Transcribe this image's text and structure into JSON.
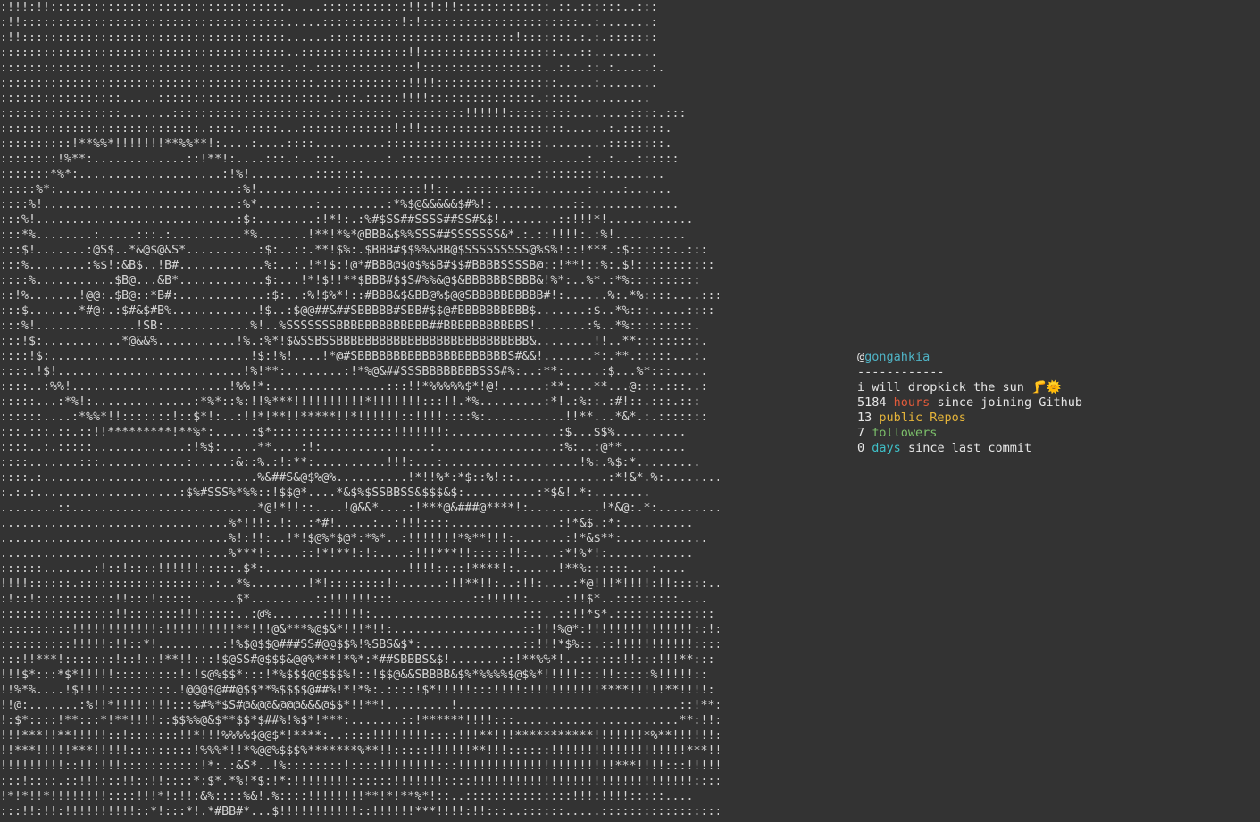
{
  "profile": {
    "at_symbol": "@",
    "username": "gongahkia",
    "separator": "------------",
    "bio": "i will dropkick the sun 🦵🌞",
    "hours": {
      "value": "5184",
      "label": "hours",
      "suffix": "since joining Github"
    },
    "repos": {
      "value": "13",
      "label": "public Repos"
    },
    "followers": {
      "value": "7",
      "label": "followers"
    },
    "days": {
      "value": "0",
      "label": "days",
      "suffix": "since last commit"
    }
  },
  "colors": {
    "background": "#333333",
    "text": "#e6e6e6",
    "username": "#4fb3c5",
    "hours": "#e05a3a",
    "repos": "#e6b53a",
    "followers": "#7cbf6a",
    "days": "#3fc0c8"
  },
  "ascii_art": [
    ":!!!:!!:::::::::::::::::::::::::::::::::.....::::::::::::!!:!:!!:::::::::::::.::.::::::..:::",
    ":!!:::::::::::::::::::::::::::::::::::::.....:::::::::::!:!::::::::::::::::::::::..:.......:",
    ":!!:::::::::::::::::::::::::::::::::::::......::::::::::::::::::::::::::!:::::::.:.:.:::::::",
    "::::::::::::::::::::::::::::::::::::::::..:::::::::::::::!!:::::::::::::::::::...::.........",
    "::::::::::::::::::::::::::::::::::::::::.::.::::::::::::::!:::::::::::::::::..::..::.:.....:.",
    "::::::::::::::::::::::::::::::::::::::::::::.::::::::::::!!!!:::::::::::::::::.....:........",
    ":::::::::::::::::.....::::::::::::::::::::::::.:::.:::::!!!!:::::::::::::::.:::::..........",
    ":::::::::::::::::.......:::::::::::::::::::::.:::::::::.:::::::::!!!!!!:::::::::........::::.:::",
    "::::::::::::::::::::::::::::.::::.:::::...:::::::::::::!:!!::::::::::::::::::::......:.::::::.",
    "::::::::::!**%%*!!!!!!!**%%**!:....:....::::..........::::::::::::::::::::::.........::::::::.",
    "::::::::!%**:.............::!**!:....:::.:..:::.......:.::::::::::::::::::::......:..:...::::::",
    ":::::::*%*:....................:!%!.........:::::::........................::::::::::........",
    ":::::%*:.........................:%!...........::::::::::::!!::..::::::::::.......:....:......",
    "::::%!...........................:%*........:.........:*%$@&&&&&$#%!:...........::.............",
    ":::%!............................:$:........:!*!:.:%#$SS##SSSS##SS#&$!........::!!!*!............",
    ":::*%........:.....:::.:..........*%.......!**!*%*@BBB&$%%SSS##SSSSSSS&*.:.::!!!!:.:%!..........",
    ":::$!.......:@S$..*&@$@&S*..........:$:..::.**!$%:.$BBB#$$%%&BB@$SSSSSSSSS@%$%!::!***.:$::::::..:::",
    ":::%........:%$!:&B$..!B#............%:..:.!*!$:!@*#BBB@$@$%$B#$$#BBBBSSSSB@::!**!::%:.$!:::::::::::",
    "::::%...........$B@...&B*............$:...!*!$!!**$BBB#$$S#%%&@$&BBBBBBSBBB&!%*:..%*.:*%::::::::::",
    "::!%.......!@@:.$B@::*B#:............:$:..:%!$%*!::#BBB&$&BB@%$@@SBBBBBBBBBB#!:......%:.*%::::....::::",
    ":::$.......*#@:.:$#&$#B%............!$..:$@@##&##SBBBBB#SBB#$$@#BBBBBBBBBB$.......:$..*%:::.....::::",
    ":::%!..............!SB:............%!..%SSSSSSSBBBBBBBBBBBBB##BBBBBBBBBBBS!.......:%..*%:::::::::.",
    ":::!$:...........*@&&%...........!%.:%*!$&SSBSSBBBBBBBBBBBBBBBBBBBBBBBBBBB&........!!..**:::::::::.",
    "::::!$:............................!$:!%!....!*@#SBBBBBBBBBBBBBBBBBBBBBS#&&!.......*:.**.:::::...:.",
    "::::.!$!..........................!%!**:........:!*%@&##SSSBBBBBBBBSSS#%:..:**:.....:$...%*:::.....",
    "::::..:%%!......................!%%!*:................:::!!*%%%%%$*!@!......:**:...**...@:::.:::..:",
    ":::::...:*%!:..............:*%*::%:!!%***!!!!!!!!!!*!!!!!!!:::!!.*%.........:*!.:%::.:#!::.:::.:::",
    "::::::....:*%%*!!:::::::!::$*!:..:!!*!**!!*****!!*!!!!!!::!!!!::::%:...........!!**...*&*.:.:::::::",
    ":::.:::.::.::!!*********!**%*:.....:$*:::::::::::::::::!!!!!!!:...............:$...$$%..........",
    "::::..:.:::::.............:!%$:.....**....:!:...............:.................:%:..:@**.........",
    "::::.......:::............:.....:&::%.:!:**:..........!!!:...:...................!%:.%$:*.........",
    "::::.:..............................%&##S&@$%@%..........!*!!%*:*$::%!::.............:*!&*.%:.........",
    ":.:.:....................:$%#SSS%*%%::!$$@*....*&$%$SSBBSS&$$$&$:..........:*$&!.*:........",
    "........::..........................*@!*!!::....!@&&*....:!***@&###@****!:..........!*&@:.*:.........",
    "................................%*!!!:.!:..:*#!.....:..:!!!::::...............:!*&$.:*:..........",
    "................................%!:!!:..!*!$@%*$@*:*%*..:!!!!!!!*%**!!!:.......:!*&$**:............",
    "................................%***!:....::!*!**!:!:....:!!!***!!:::::!!:....:*!%*!:............",
    "::::::.......:!::!::::!!!!!!:::::.$*:....................!!!!::::!****!:......!**%::::::...:....",
    "!!!!::::::.::::::::::::::::::.:..*%........!*!::::::::!:......:!!**!!:..:!!:....:*@!!!*!!!!:!!:::::..",
    ":!::!:::::::::::!!:::!:::::......$*.........::!!!!!!:::...........::!!!!!:.....:!!$*..:::::::::....",
    "::::::::::::::::!!:::::::!!!:::::..:@%.......:!!!!!:.....................:::..::!!*$*.::::::::::::::",
    "::::::::::!!!!!!!!!!!!:!!!!!!!!!!**!!!@&***%@$&*!!!*!!:..................::!!!%@*:!!!!!!!!!!!!!!!::!::",
    "::::::::::!!!!!:!!::*!.........:!%$@$$@###SS#@@$$%!%SBS&$*:..............::!!!*$%::.::!!!!!!!!!!!::::",
    ":::!!***!:::::::!::!::!**!!:::!$@SS#@$$$&@@%***!*%*:*##SBBBS&$!.......::!**%%*!..::::::!!:::!!!**:::",
    "!!!$*:::*$*!!!!!:::::::::!:!$@%$$*:::!*%$$$@@$$$%!::!$$@&&SBBBB&$%*%%%%$@$%*!!!!!:::!!:::::%!!!!!::",
    "!!%*%....!$!!!!:::::::::.!@@@$@##@$$**%$$$$@##%!*!*%:.::::!$*!!!!!:::!!!!:!!!!!!!!!!****!!!!!**!!!!:",
    "!!@:.......:%!!*!!!!:!!!:::%#%*$S#@&@@&@@@&&&@$$*!!**!.........!...............................::!**::!!***!",
    "!:$*::::!**:::*!**!!!!::$$%%@&$**$$*$##%!%$*!***:.......::!******!!!!:::.......................**:!!:::!",
    "!!!***!!**!!!!!::!:::::::!!*!!!%%%%$@@$*!****:..::::!!!!!!!!::::!!!**!!!***********!!!!!!!*%**!!!!!!:",
    "!!***!!!!!***!!!!!:::::::::!%%%*!!*%@@%$$$%*******%**!!:::::!!!!!!**!!!::::::!!!!!!!!!!!!!!!!!!!***!!!:",
    "!!!!!!!!!::!!:!!!:::::::::::!*:.:&S*..!%::::::::!::::!!!!!!!!:::!!!!!!!!!!!!!!!!!!!!!!***!!!!:::!!!!!!!:::",
    ":::!::::.::!!!:::!!::!!::::*:$*.*%!*$:!*:!!!!!!!!::::::!!!!!!!::::!!!!!!!!!!!!!!!!!!!!!!!!!!!!!!!:::::::::.",
    "!*!*!!*!!!!!!!!::::!!!*!:!!:&%::::%&!.%::::!!!!!!!!**!*!**%*!::..:::::::::::::::!!!:!!!!:::::....",
    ":::!!:!!:!!!!!!!!!!::*!:::*!.*#BB#*...$!!!!!!!!!!!::!!!!!!***!!!!:!!:::..::::::.....:::::::::::::::::..."
  ]
}
